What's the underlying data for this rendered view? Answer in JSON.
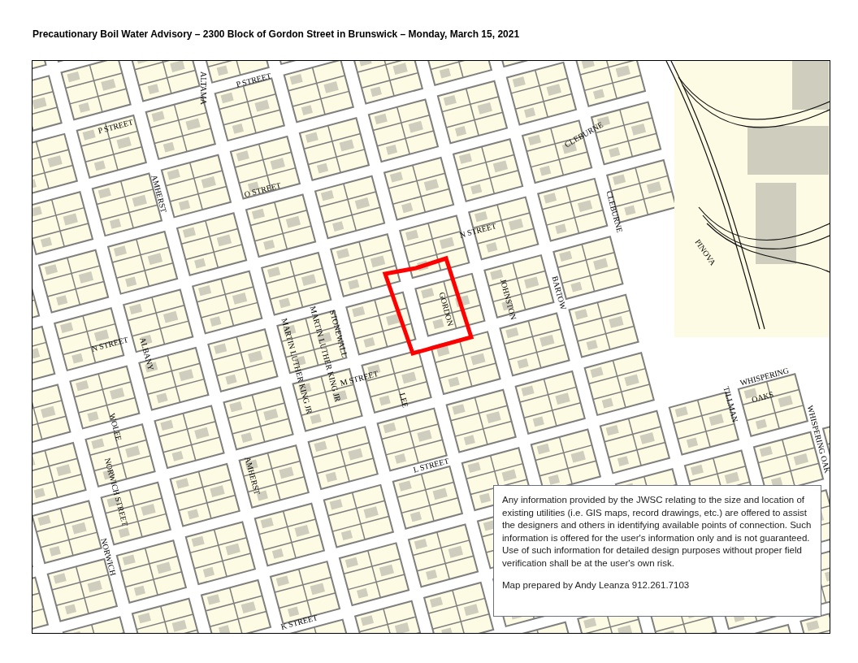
{
  "title": "Precautionary Boil Water Advisory – 2300 Block of Gordon Street in Brunswick – Monday, March 15, 2021",
  "map": {
    "street_labels": [
      {
        "text": "ALTAMA"
      },
      {
        "text": "P STREET"
      },
      {
        "text": "P STREET"
      },
      {
        "text": "AMHERST"
      },
      {
        "text": "O STREET"
      },
      {
        "text": "N STREET"
      },
      {
        "text": "CLEBURNE"
      },
      {
        "text": "CLEBURNE"
      },
      {
        "text": "PINOVA"
      },
      {
        "text": "GORDON"
      },
      {
        "text": "JOHNSTON"
      },
      {
        "text": "BARTOW"
      },
      {
        "text": "STONEWALL"
      },
      {
        "text": "MARTIN LUTHER KING JR"
      },
      {
        "text": "MARTIN LUTHER KING JR"
      },
      {
        "text": "N STREET"
      },
      {
        "text": "ALBANY"
      },
      {
        "text": "M STREET"
      },
      {
        "text": "LEE"
      },
      {
        "text": "WOLFE"
      },
      {
        "text": "NORWICH STREET"
      },
      {
        "text": "NORWICH"
      },
      {
        "text": "AMHERST"
      },
      {
        "text": "L STREET"
      },
      {
        "text": "K STREET"
      },
      {
        "text": "TILLMAN"
      },
      {
        "text": "WHISPERING"
      },
      {
        "text": "OAKS"
      },
      {
        "text": "WHISPERING OAK"
      }
    ]
  },
  "disclaimer": {
    "paragraphs": [
      "Any information provided by the JWSC relating to the size and location of existing utilities (i.e. GIS maps, record drawings, etc.) are offered to assist the designers and others in identifying available points of connection. Such information is offered for the user's information only and is not guaranteed. Use of such information for detailed design purposes without proper field verification shall be at the user's own risk.",
      "Map prepared by Andy Leanza 912.261.7103"
    ]
  }
}
